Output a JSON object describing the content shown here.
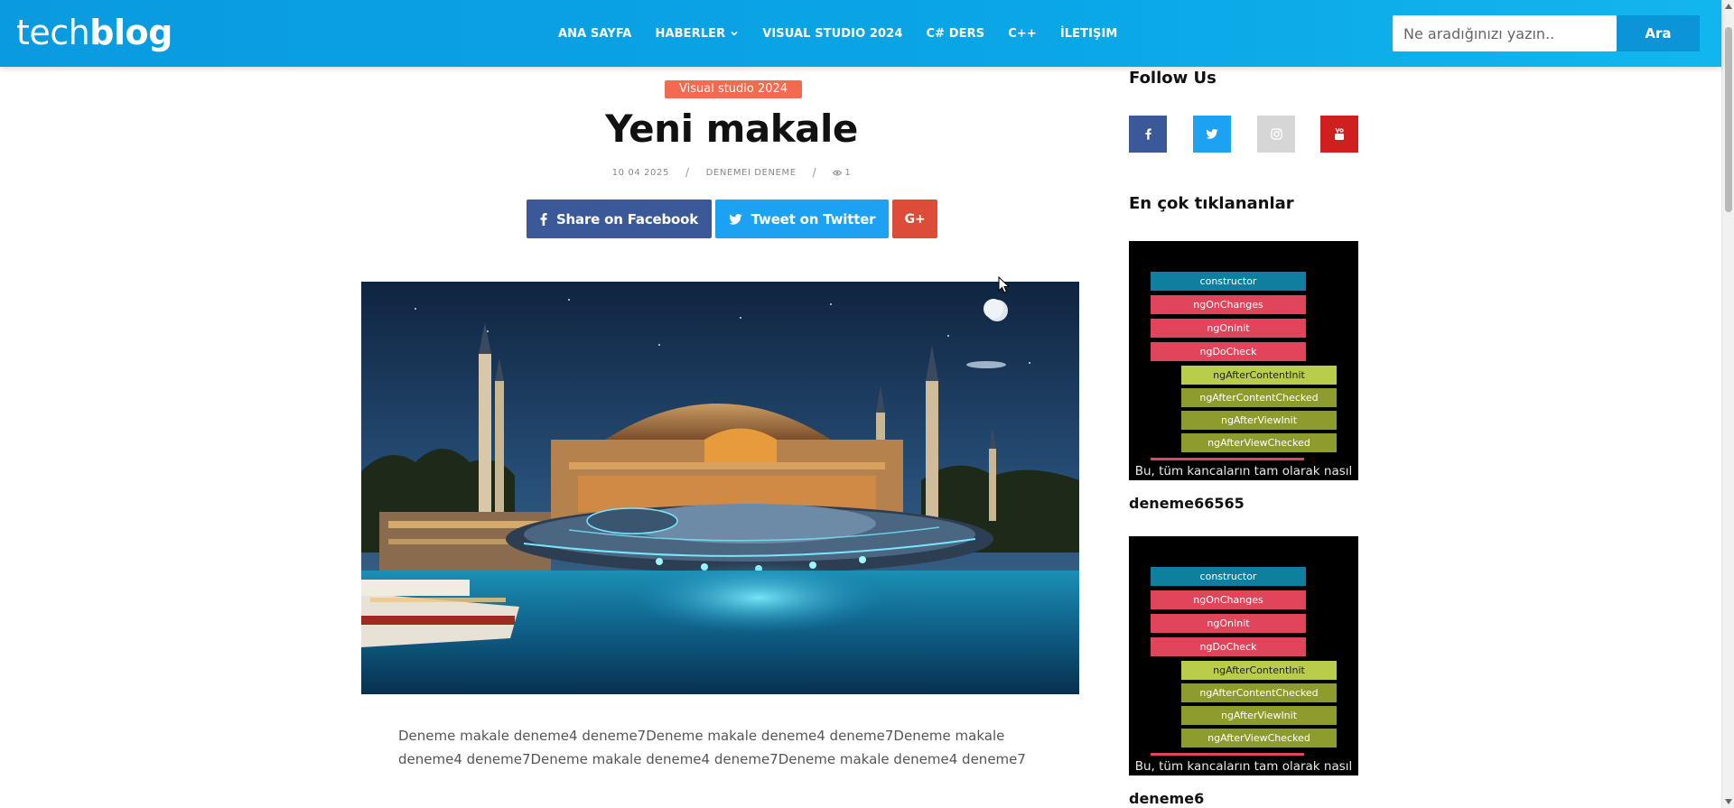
{
  "header": {
    "logo_light": "tech",
    "logo_bold": "blog",
    "nav": [
      "ANA SAYFA",
      "HABERLER",
      "VISUAL STUDIO 2024",
      "C# DERS",
      "C++",
      "İLETIŞIM"
    ],
    "search_placeholder": "Ne aradığınızı yazın..",
    "search_button": "Ara"
  },
  "article": {
    "category": "Visual studio 2024",
    "title": "Yeni makale",
    "date": "10 04 2025",
    "author": "DENEMEI DENEME",
    "views": "1",
    "share_facebook": "Share on Facebook",
    "share_twitter": "Tweet on Twitter",
    "share_google": "G+",
    "body_line1": "Deneme makale deneme4 deneme7Deneme makale deneme4 deneme7Deneme makale",
    "body_line2": "deneme4 deneme7Deneme makale deneme4 deneme7Deneme makale deneme4 deneme7"
  },
  "sidebar": {
    "follow_title": "Follow Us",
    "social_icons": [
      "facebook-icon",
      "twitter-icon",
      "instagram-icon",
      "youtube-icon"
    ],
    "popular_title": "En çok tıklananlar",
    "posts": [
      {
        "title": "deneme66565",
        "thumb_rows": [
          "constructor",
          "ngOnChanges",
          "ngOnInit",
          "ngDoCheck",
          "ngAfterContentInit",
          "ngAfterContentChecked",
          "ngAfterViewInit",
          "ngAfterViewChecked"
        ],
        "thumb_caption": "Bu, tüm kancaların tam olarak nasıl"
      },
      {
        "title": "deneme6",
        "thumb_rows": [
          "constructor",
          "ngOnChanges",
          "ngOnInit",
          "ngDoCheck",
          "ngAfterContentInit",
          "ngAfterContentChecked",
          "ngAfterViewInit",
          "ngAfterViewChecked"
        ],
        "thumb_caption": "Bu, tüm kancaların tam olarak nasıl"
      }
    ]
  },
  "colors": {
    "header": "#0aa6e6",
    "category": "#f26a4f",
    "facebook": "#3b5998",
    "twitter": "#1da1f2",
    "google": "#dd4b39",
    "youtube": "#d01f1f"
  }
}
